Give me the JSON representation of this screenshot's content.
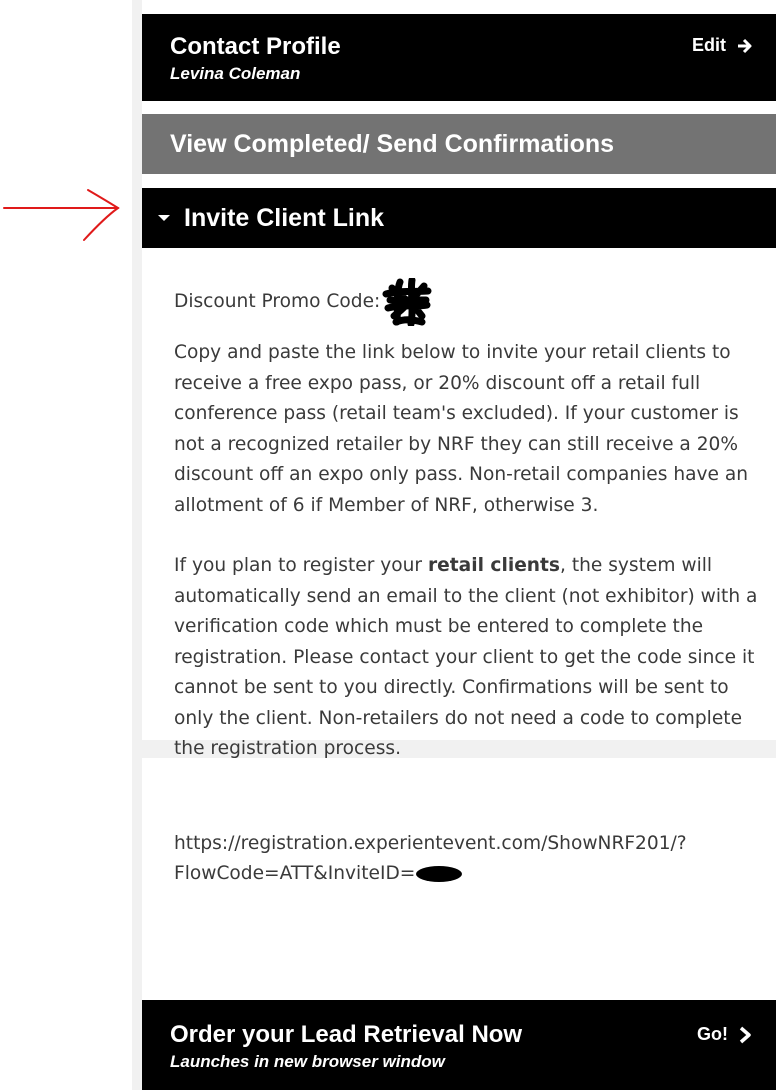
{
  "contact_profile": {
    "title": "Contact Profile",
    "name": "Levina Coleman",
    "edit_label": "Edit"
  },
  "view_completed": {
    "label": "View Completed/ Send Confirmations"
  },
  "invite": {
    "header": "Invite Client Link",
    "promo_label": "Discount Promo Code:",
    "paragraph1": "Copy and paste the link below to invite your retail clients to receive a free expo pass, or 20% discount off a retail full conference pass (retail team's excluded). If your customer is not a recognized retailer by NRF they can still receive a 20% discount off an expo only pass. Non-retail companies have an allotment of 6 if Member of NRF, otherwise 3.",
    "paragraph2_before": "If you plan to register your ",
    "paragraph2_bold": "retail clients",
    "paragraph2_after": ", the system will automatically send an email to the client (not exhibitor) with a verification code which must be entered to complete the registration. Please contact your client to get the code since it cannot be sent to you directly. Confirmations will be sent to only the client. Non-retailers do not need a code to complete the registration process.",
    "link_line1": "https://registration.experientevent.com/ShowNRF201/?",
    "link_line2": "FlowCode=ATT&InviteID="
  },
  "lead_retrieval": {
    "title": "Order your Lead Retrieval Now",
    "subtitle": "Launches in new browser window",
    "go_label": "Go!"
  },
  "colors": {
    "bar_black": "#000000",
    "bar_gray": "#737373",
    "body_text": "#3a3a3a",
    "annotation_red": "#e01a1a"
  }
}
